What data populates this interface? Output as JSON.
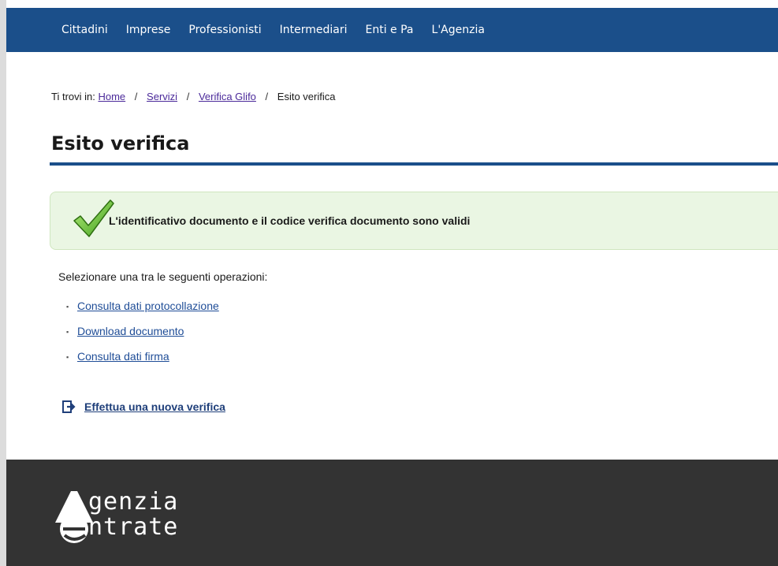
{
  "nav": {
    "items": [
      "Cittadini",
      "Imprese",
      "Professionisti",
      "Intermediari",
      "Enti e Pa",
      "L'Agenzia"
    ]
  },
  "breadcrumb": {
    "prefix": "Ti trovi in:",
    "items": [
      "Home",
      "Servizi",
      "Verifica Glifo"
    ],
    "current": "Esito verifica",
    "separator": "/"
  },
  "page": {
    "title": "Esito verifica"
  },
  "result": {
    "message": "L'identificativo documento e il codice verifica documento sono validi",
    "icon": "checkmark-icon",
    "color": "#eaf6e3"
  },
  "operations": {
    "intro": "Selezionare una tra le seguenti operazioni:",
    "links": [
      "Consulta dati protocollazione",
      "Download documento",
      "Consulta dati firma"
    ],
    "bullet_icon": "bullet-icon"
  },
  "new_verification": {
    "label": "Effettua una nuova verifica",
    "icon": "exit-door-icon"
  },
  "footer": {
    "logo_line1": "genzia",
    "logo_line2": "ntrate",
    "logo_icon": "agenzia-entrate-logo"
  },
  "colors": {
    "nav_bg": "#1b4f8a",
    "footer_bg": "#333333",
    "link": "#1f4d97"
  }
}
